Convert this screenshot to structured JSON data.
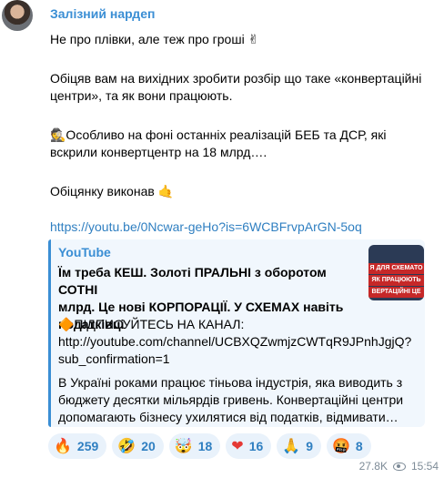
{
  "message": {
    "author": "Залізний нардеп",
    "lines": [
      "Не про плівки, але теж про гроші ✌",
      "Обіцяв вам на вихідних зробити розбір що таке «конвертаційні",
      "центри», та як вони працюють.",
      "🕵Особливо на фоні останніх реалізацій БЕБ та ДСР, які",
      "вскрили конвертцентр на 18 млрд….",
      "Обіцянку виконав 🤙"
    ],
    "link": "https://youtu.be/0Ncwar-geHo?is=6WCBFrvpArGN-5oq"
  },
  "preview": {
    "site": "YouTube",
    "title_lines": [
      "Їм треба КЕШ. Золоті ПРАЛЬНІ з оборотом СОТНІ",
      "млрд. Це нові КОРПОРАЦІЇ. У СХЕМАХ навіть",
      "податківці"
    ],
    "desc_lines": [
      "🔶ПІДПИСУЙТЕСЬ НА КАНАЛ:",
      "http://youtube.com/channel/UCBXQZwmjzCWTqR9JPnhJgjQ?",
      "sub_confirmation=1",
      "В Україні роками працює тіньова індустрія, яка виводить з",
      "бюджету десятки мільярдів гривень. Конвертаційні центри",
      "допомагають бізнесу ухилятися від податків, відмивати…"
    ],
    "thumb_text": [
      "Я ДЛЯ СХЕМАТО",
      "ЯК ПРАЦЮЮТЬ",
      "ВЕРТАЦІЙНІ ЦЕ"
    ]
  },
  "reactions": [
    {
      "emoji": "🔥",
      "count": "259"
    },
    {
      "emoji": "🤣",
      "count": "20"
    },
    {
      "emoji": "🤯",
      "count": "18"
    },
    {
      "emoji": "❤",
      "count": "16"
    },
    {
      "emoji": "🙏",
      "count": "9"
    },
    {
      "emoji": "🤬",
      "count": "8"
    }
  ],
  "meta": {
    "views": "27.8K",
    "time": "15:54"
  }
}
